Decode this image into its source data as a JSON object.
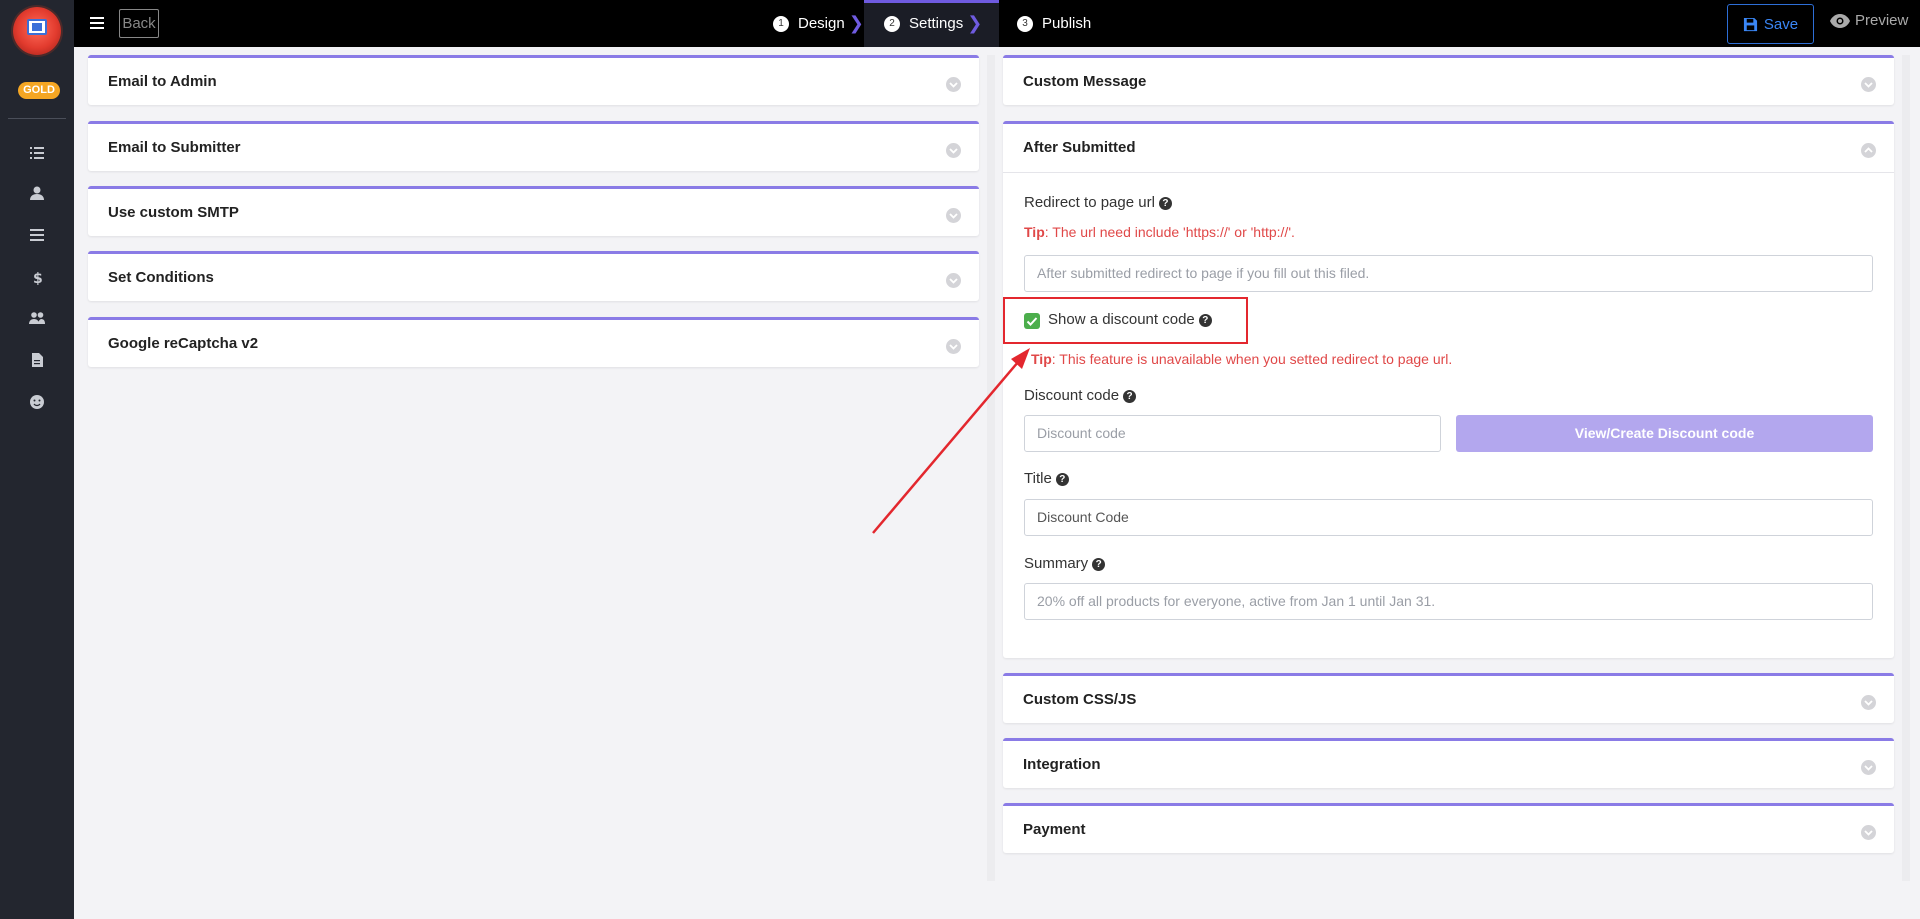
{
  "sidebar": {
    "badge": "GOLD",
    "icons": [
      "list-icon",
      "user-icon",
      "menu-icon",
      "dollar-icon",
      "users-icon",
      "document-icon",
      "smile-icon"
    ]
  },
  "topbar": {
    "back_label": "Back",
    "steps": [
      {
        "num": "1",
        "label": "Design"
      },
      {
        "num": "2",
        "label": "Settings"
      },
      {
        "num": "3",
        "label": "Publish"
      }
    ],
    "save_label": "Save",
    "preview_label": "Preview"
  },
  "left_panels": [
    {
      "title": "Email to Admin"
    },
    {
      "title": "Email to Submitter"
    },
    {
      "title": "Use custom SMTP"
    },
    {
      "title": "Set Conditions"
    },
    {
      "title": "Google reCaptcha v2"
    }
  ],
  "right_panels": {
    "custom_message": "Custom Message",
    "after_submitted": {
      "title": "After Submitted",
      "redirect_label": "Redirect to page url",
      "redirect_tip_prefix": "Tip",
      "redirect_tip": ": The url need include 'https://' or 'http://'.",
      "redirect_placeholder": "After submitted redirect to page if you fill out this filed.",
      "show_discount_label": "Show a discount code",
      "show_discount_checked": true,
      "discount_tip_prefix": "Tip",
      "discount_tip": ": This feature is unavailable when you setted redirect to page url.",
      "discount_code_label": "Discount code",
      "discount_code_placeholder": "Discount code",
      "view_create_button": "View/Create Discount code",
      "title_label": "Title",
      "title_value": "Discount Code",
      "summary_label": "Summary",
      "summary_placeholder": "20% off all products for everyone, active from Jan 1 until Jan 31."
    },
    "custom_css_js": "Custom CSS/JS",
    "integration": "Integration",
    "payment": "Payment"
  },
  "colors": {
    "accent": "#8a7be6",
    "tip": "#e04848",
    "save": "#3a86f5",
    "highlight": "#e3272e"
  }
}
